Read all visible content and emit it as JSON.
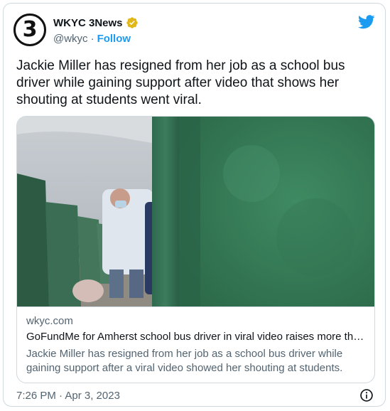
{
  "author": {
    "avatar_text": "3",
    "display_name": "WKYC 3News",
    "handle": "@wkyc",
    "separator": "·",
    "follow_label": "Follow"
  },
  "tweet": {
    "text": "Jackie Miller has resigned from her job as a school bus driver while gaining support after video that shows her shouting at students went viral."
  },
  "link_card": {
    "domain": "wkyc.com",
    "title": "GoFundMe for Amherst school bus driver in viral video raises more tha...",
    "description": "Jackie Miller has resigned from her job as a school bus driver while gaining support after a viral video showed her shouting at students."
  },
  "footer": {
    "timestamp": "7:26 PM · Apr 3, 2023"
  },
  "colors": {
    "accent": "#1d9bf0",
    "verified_badge": "#e2b719",
    "text_primary": "#0f1419",
    "text_secondary": "#536471",
    "border": "#cfd9de"
  },
  "icons": {
    "verified": "verified-badge-icon",
    "brand": "twitter-bird-icon",
    "info": "info-icon"
  }
}
